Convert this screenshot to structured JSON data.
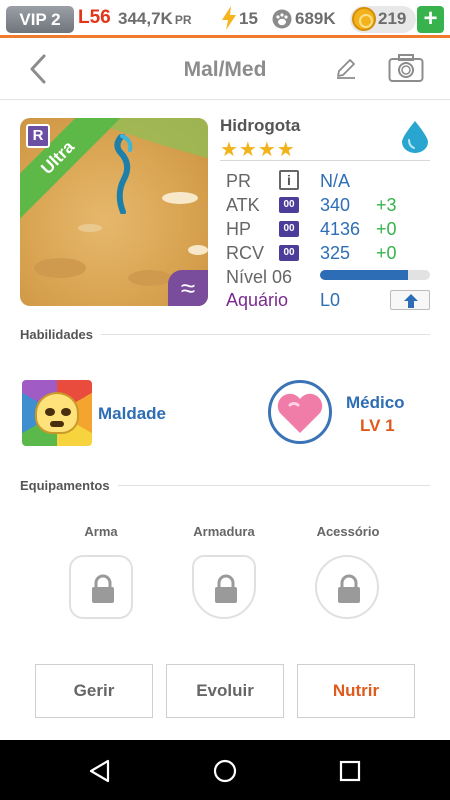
{
  "status": {
    "vip": "VIP 2",
    "level": "L56",
    "power": "344,7K",
    "power_unit": "PR",
    "energy": "15",
    "food": "689K",
    "coins": "219",
    "add": "+"
  },
  "header": {
    "title": "Mal/Med"
  },
  "creature": {
    "name": "Hidrogota",
    "stars": "★★★★",
    "rarity_badge": "R",
    "tier": "Ultra",
    "element_symbol": "≈",
    "stats": [
      {
        "label": "PR",
        "value": "N/A",
        "bonus": ""
      },
      {
        "label": "ATK",
        "value": "340",
        "bonus": "+3"
      },
      {
        "label": "HP",
        "value": "4136",
        "bonus": "+0"
      },
      {
        "label": "RCV",
        "value": "325",
        "bonus": "+0"
      }
    ],
    "stat_badge": "00",
    "info_glyph": "i",
    "level_label": "Nível 06",
    "level_progress": 0.8,
    "aquario_label": "Aquário",
    "aquario_value": "L0"
  },
  "abilities": {
    "section_title": "Habilidades",
    "items": [
      {
        "name": "Maldade",
        "level": ""
      },
      {
        "name": "Médico",
        "level": "LV 1"
      }
    ]
  },
  "equipment": {
    "section_title": "Equipamentos",
    "slots": [
      "Arma",
      "Armadura",
      "Acessório"
    ]
  },
  "actions": {
    "manage": "Gerir",
    "evolve": "Evoluir",
    "feed": "Nutrir"
  },
  "colors": {
    "accent": "#f07b2c",
    "blue": "#2e6eb5",
    "green": "#37b24d",
    "purple": "#7a2b8f",
    "ribbon": "#5eb847"
  },
  "icons": [
    "bolt-icon",
    "paw-icon",
    "coin-icon",
    "plus-icon",
    "back-icon",
    "edit-icon",
    "camera-icon",
    "water-drop-icon",
    "info-icon",
    "upgrade-arrow-icon",
    "skull-icon",
    "heart-icon",
    "lock-icon",
    "nav-back-icon",
    "nav-home-icon",
    "nav-recents-icon"
  ]
}
